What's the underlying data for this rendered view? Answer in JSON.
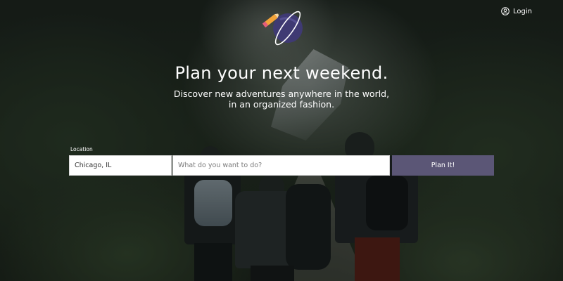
{
  "header": {
    "login_label": "Login",
    "login_icon": "user-circle-icon"
  },
  "logo": {
    "icon": "planet-pencil-logo",
    "planet_color": "#3f3a73",
    "pencil_color": "#f2a33a"
  },
  "hero": {
    "title": "Plan your next weekend.",
    "subtitle_line1": "Discover new adventures anywhere in the world,",
    "subtitle_line2": "in an organized fashion."
  },
  "search": {
    "location_label": "Location",
    "location_value": "Chicago, IL",
    "activity_placeholder": "What do you want to do?",
    "submit_label": "Plan It!"
  },
  "colors": {
    "accent": "#5b5676",
    "text": "#ffffff"
  }
}
